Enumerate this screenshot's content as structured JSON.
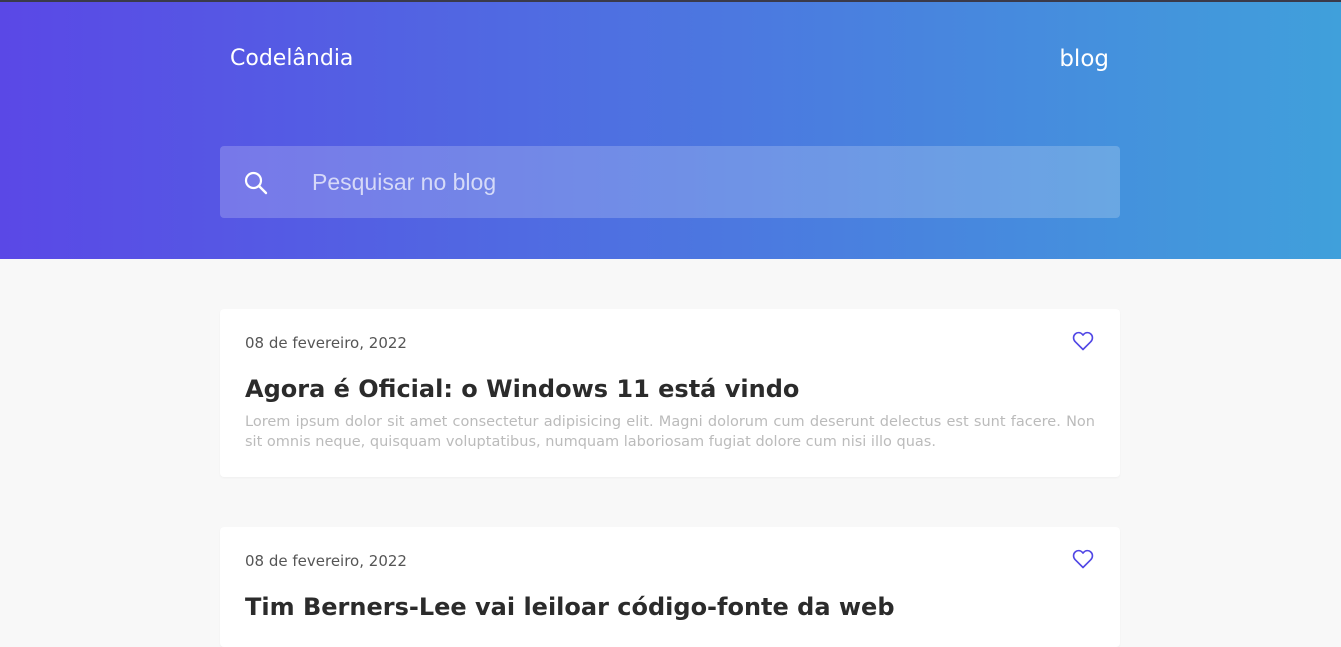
{
  "colors": {
    "gradient_start": "#5A48E6",
    "gradient_end": "#40A0DB",
    "accent": "#5046E5",
    "background": "#F8F8F8",
    "title_text": "#2B2B2B",
    "excerpt_text": "#BBBBBB"
  },
  "header": {
    "brand": "Codelândia",
    "nav_link": "blog",
    "search": {
      "placeholder": "Pesquisar no blog",
      "value": "",
      "icon": "search-icon"
    }
  },
  "posts": [
    {
      "date": "08 de fevereiro, 2022",
      "title": "Agora é Oficial: o Windows 11 está vindo",
      "excerpt": "Lorem ipsum dolor sit amet consectetur adipisicing elit. Magni dolorum cum deserunt delectus est sunt facere. Non sit omnis neque, quisquam voluptatibus, numquam laboriosam fugiat dolore cum nisi illo quas.",
      "like_icon": "heart-icon"
    },
    {
      "date": "08 de fevereiro, 2022",
      "title": "Tim Berners-Lee vai leiloar código-fonte da web",
      "excerpt": "",
      "like_icon": "heart-icon"
    }
  ]
}
